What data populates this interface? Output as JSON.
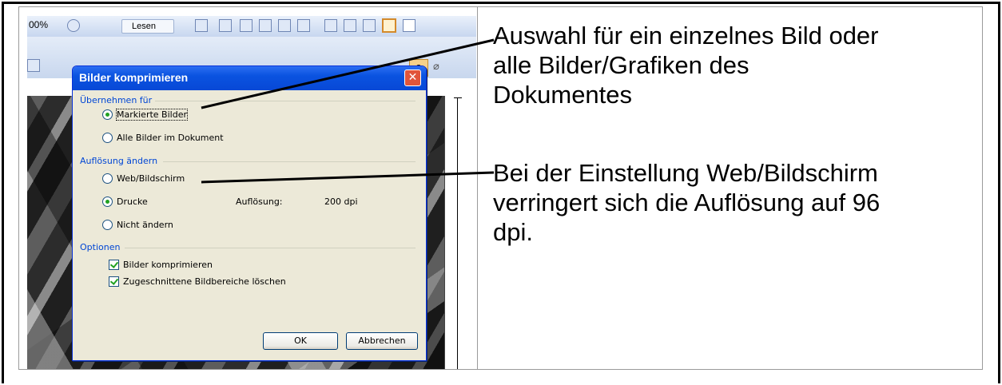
{
  "toolbar": {
    "zoom_label": "00%",
    "lesen_label": "Lesen"
  },
  "dialog": {
    "title": "Bilder komprimieren",
    "close_label": "✕",
    "sections": {
      "apply": {
        "label": "Übernehmen für",
        "options": [
          {
            "label": "Markierte Bilder",
            "checked": true
          },
          {
            "label": "Alle Bilder im Dokument",
            "checked": false
          }
        ]
      },
      "resolution": {
        "label": "Auflösung ändern",
        "options": [
          {
            "label": "Web/Bildschirm",
            "checked": false
          },
          {
            "label": "Drucke",
            "checked": true
          },
          {
            "label": "Nicht ändern",
            "checked": false
          }
        ],
        "resolution_label": "Auflösung:",
        "resolution_value": "200 dpi"
      },
      "options": {
        "label": "Optionen",
        "checkboxes": [
          {
            "label": "Bilder komprimieren",
            "checked": true
          },
          {
            "label": "Zugeschnittene Bildbereiche löschen",
            "checked": true
          }
        ]
      }
    },
    "buttons": {
      "ok": "OK",
      "cancel": "Abbrechen"
    }
  },
  "callouts": {
    "first": [
      "Auswahl für ein einzelnes Bild oder",
      "alle Bilder/Grafiken des",
      "Dokumentes"
    ],
    "second": [
      "Bei der Einstellung Web/Bildschirm",
      "verringert sich die Auflösung auf 96",
      "dpi."
    ]
  },
  "colors": {
    "titlebar": "#0a53e0",
    "dialog_bg": "#ece9d8",
    "group_label": "#0046d5"
  }
}
